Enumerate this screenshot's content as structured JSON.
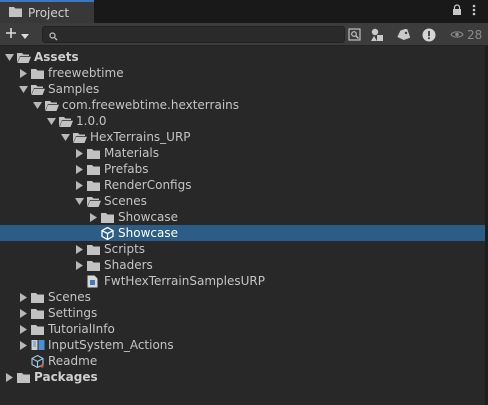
{
  "window": {
    "tab_label": "Project",
    "hidden_count": "28"
  },
  "toolbar": {
    "search_placeholder": ""
  },
  "tree": [
    {
      "label": "Assets",
      "level": 0,
      "arrow": "down",
      "icon": "folder-open-icon",
      "bold": true,
      "selected": false
    },
    {
      "label": "freewebtime",
      "level": 1,
      "arrow": "right",
      "icon": "folder-icon",
      "bold": false,
      "selected": false
    },
    {
      "label": "Samples",
      "level": 1,
      "arrow": "down",
      "icon": "folder-open-icon",
      "bold": false,
      "selected": false
    },
    {
      "label": "com.freewebtime.hexterrains",
      "level": 2,
      "arrow": "down",
      "icon": "folder-open-icon",
      "bold": false,
      "selected": false
    },
    {
      "label": "1.0.0",
      "level": 3,
      "arrow": "down",
      "icon": "folder-open-icon",
      "bold": false,
      "selected": false
    },
    {
      "label": "HexTerrains_URP",
      "level": 4,
      "arrow": "down",
      "icon": "folder-open-icon",
      "bold": false,
      "selected": false
    },
    {
      "label": "Materials",
      "level": 5,
      "arrow": "right",
      "icon": "folder-icon",
      "bold": false,
      "selected": false
    },
    {
      "label": "Prefabs",
      "level": 5,
      "arrow": "right",
      "icon": "folder-icon",
      "bold": false,
      "selected": false
    },
    {
      "label": "RenderConfigs",
      "level": 5,
      "arrow": "right",
      "icon": "folder-icon",
      "bold": false,
      "selected": false
    },
    {
      "label": "Scenes",
      "level": 5,
      "arrow": "down",
      "icon": "folder-open-icon",
      "bold": false,
      "selected": false
    },
    {
      "label": "Showcase",
      "level": 6,
      "arrow": "right",
      "icon": "folder-icon",
      "bold": false,
      "selected": false
    },
    {
      "label": "Showcase",
      "level": 6,
      "arrow": "none",
      "icon": "unity-scene-icon",
      "bold": false,
      "selected": true
    },
    {
      "label": "Scripts",
      "level": 5,
      "arrow": "right",
      "icon": "folder-icon",
      "bold": false,
      "selected": false
    },
    {
      "label": "Shaders",
      "level": 5,
      "arrow": "right",
      "icon": "folder-icon",
      "bold": false,
      "selected": false
    },
    {
      "label": "FwtHexTerrainSamplesURP",
      "level": 5,
      "arrow": "none",
      "icon": "assembly-definition-icon",
      "bold": false,
      "selected": false
    },
    {
      "label": "Scenes",
      "level": 1,
      "arrow": "right",
      "icon": "folder-icon",
      "bold": false,
      "selected": false
    },
    {
      "label": "Settings",
      "level": 1,
      "arrow": "right",
      "icon": "folder-icon",
      "bold": false,
      "selected": false
    },
    {
      "label": "TutorialInfo",
      "level": 1,
      "arrow": "right",
      "icon": "folder-icon",
      "bold": false,
      "selected": false
    },
    {
      "label": "InputSystem_Actions",
      "level": 1,
      "arrow": "right",
      "icon": "input-actions-icon",
      "bold": false,
      "selected": false
    },
    {
      "label": "Readme",
      "level": 1,
      "arrow": "none",
      "icon": "readme-cube-icon",
      "bold": false,
      "selected": false
    },
    {
      "label": "Packages",
      "level": 0,
      "arrow": "right",
      "icon": "folder-icon",
      "bold": true,
      "selected": false
    }
  ],
  "colors": {
    "selection": "#2c5d87",
    "background": "#282828",
    "toolbar": "#3c3c3c",
    "tab_active": "#383838",
    "text": "#c4c4c4"
  }
}
